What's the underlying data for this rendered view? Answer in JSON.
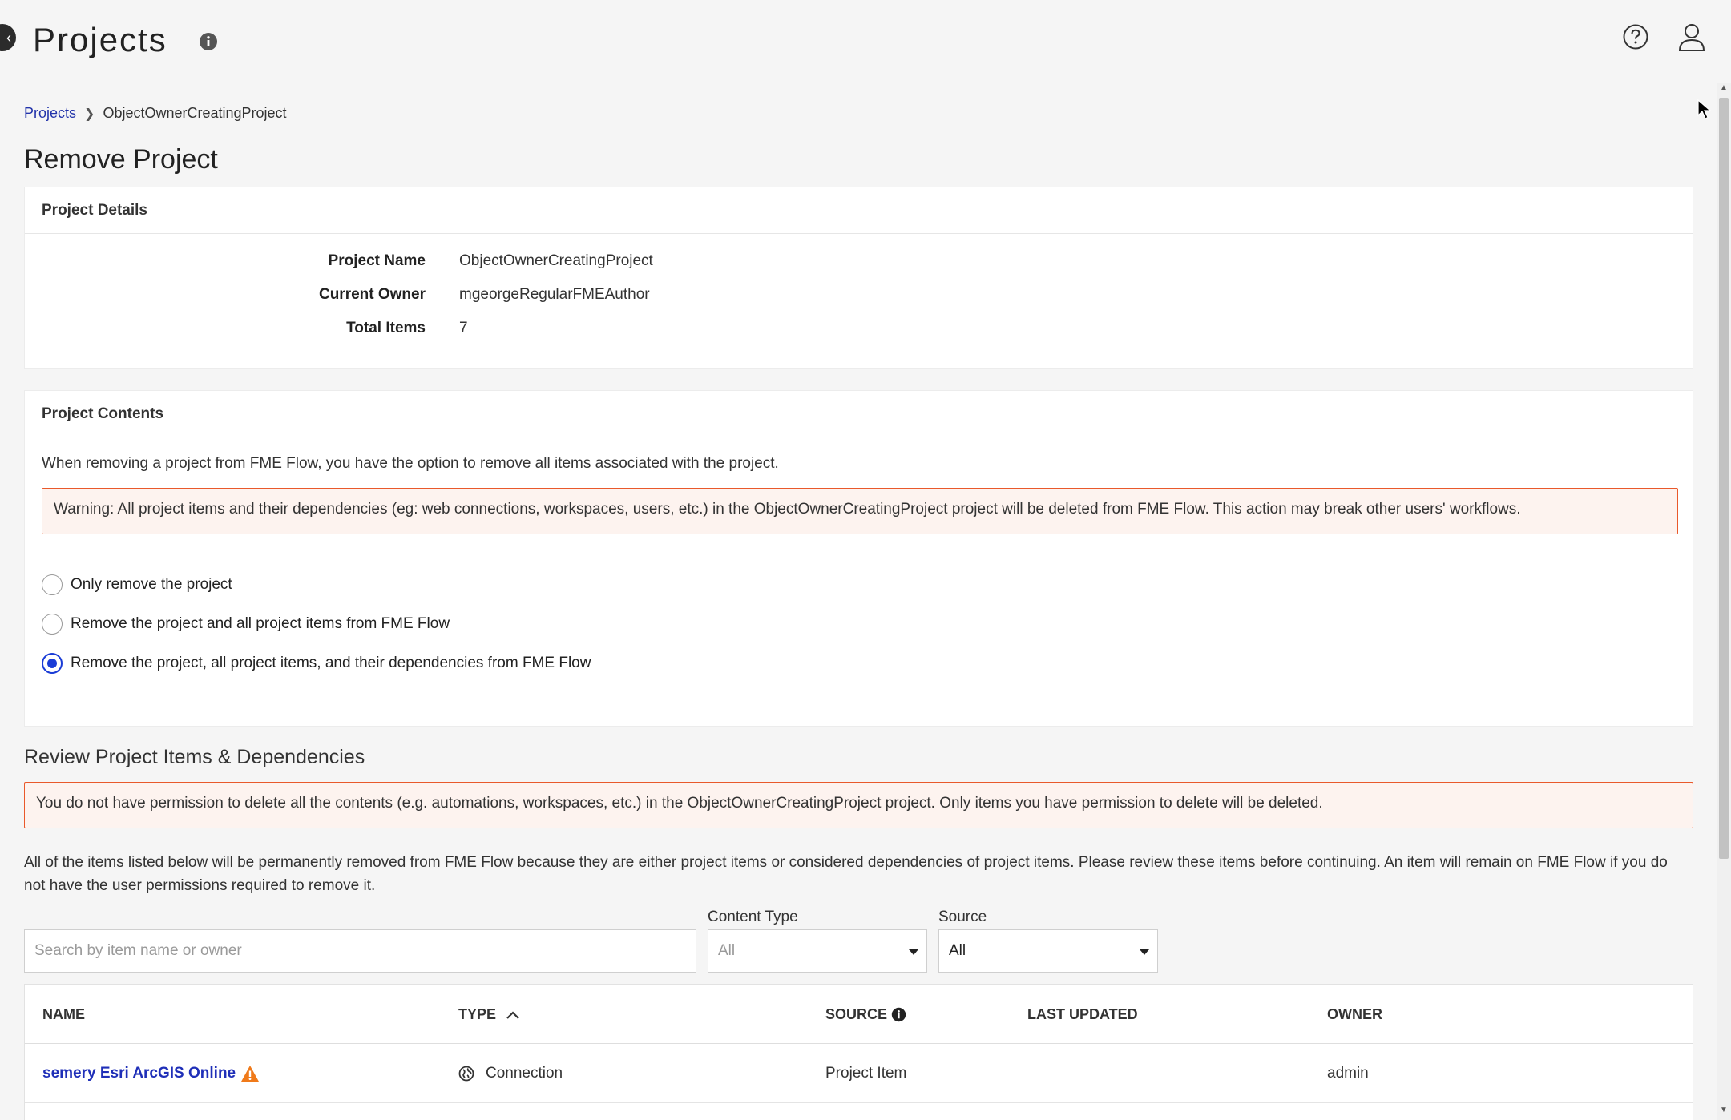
{
  "header": {
    "title": "Projects"
  },
  "breadcrumb": {
    "root": "Projects",
    "current": "ObjectOwnerCreatingProject"
  },
  "page_title": "Remove Project",
  "details": {
    "header": "Project Details",
    "rows": [
      {
        "label": "Project Name",
        "value": "ObjectOwnerCreatingProject"
      },
      {
        "label": "Current Owner",
        "value": "mgeorgeRegularFMEAuthor"
      },
      {
        "label": "Total Items",
        "value": "7"
      }
    ]
  },
  "contents": {
    "header": "Project Contents",
    "description": "When removing a project from FME Flow, you have the option to remove all items associated with the project.",
    "warning": "Warning: All project items and their dependencies (eg: web connections, workspaces, users, etc.) in the ObjectOwnerCreatingProject project will be deleted from FME Flow. This action may break other users' workflows.",
    "options": [
      {
        "label": "Only remove the project",
        "selected": false
      },
      {
        "label": "Remove the project and all project items from FME Flow",
        "selected": false
      },
      {
        "label": "Remove the project, all project items, and their dependencies from FME Flow",
        "selected": true
      }
    ]
  },
  "review": {
    "title": "Review Project Items & Dependencies",
    "warning": "You do not have permission to delete all the contents (e.g. automations, workspaces, etc.) in the ObjectOwnerCreatingProject project. Only items you have permission to delete will be deleted.",
    "description": "All of the items listed below will be permanently removed from FME Flow because they are either project items or considered dependencies of project items. Please review these items before continuing. An item will remain on FME Flow if you do not have the user permissions required to remove it."
  },
  "filters": {
    "search_placeholder": "Search by item name or owner",
    "content_type_label": "Content Type",
    "content_type_value": "All",
    "source_label": "Source",
    "source_value": "All"
  },
  "table": {
    "columns": {
      "name": "NAME",
      "type": "TYPE",
      "source": "SOURCE",
      "last_updated": "LAST UPDATED",
      "owner": "OWNER"
    },
    "rows": [
      {
        "name": "semery Esri ArcGIS Online",
        "type": "Connection",
        "source": "Project Item",
        "last_updated": "",
        "owner": "admin"
      }
    ]
  },
  "colors": {
    "accent": "#1a3cd6",
    "link": "#2233aa",
    "warning_border": "#e9592b",
    "warning_bg": "#fdf3ef",
    "warn_icon": "#f07a1a"
  }
}
